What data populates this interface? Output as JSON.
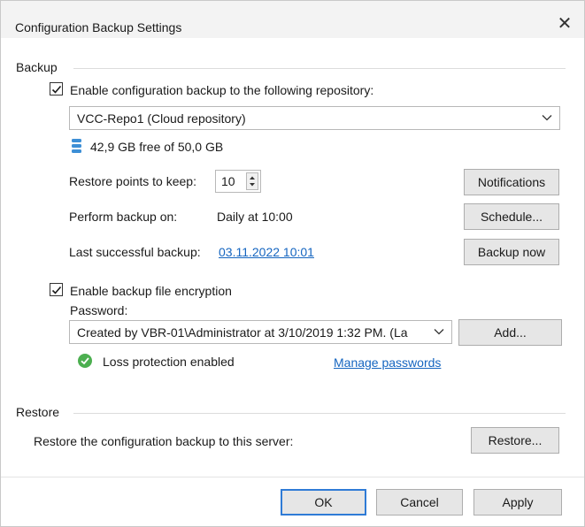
{
  "dialog": {
    "title": "Configuration Backup Settings"
  },
  "backup": {
    "group_label": "Backup",
    "enable_label": "Enable configuration backup to the following repository:",
    "enabled": true,
    "repository": "VCC-Repo1 (Cloud repository)",
    "storage_info": "42,9 GB free of 50,0 GB",
    "restore_points_label": "Restore points to keep:",
    "restore_points_value": "10",
    "notifications_label": "Notifications",
    "perform_label": "Perform backup on:",
    "perform_value": "Daily at 10:00",
    "schedule_label": "Schedule...",
    "last_label": "Last successful backup:",
    "last_value": "03.11.2022 10:01",
    "backup_now_label": "Backup now"
  },
  "encryption": {
    "enable_label": "Enable backup file encryption",
    "enabled": true,
    "password_label": "Password:",
    "password_value": "Created by VBR-01\\Administrator at 3/10/2019 1:32 PM. (La",
    "add_label": "Add...",
    "status": "Loss protection enabled",
    "manage_link": "Manage passwords"
  },
  "restore": {
    "group_label": "Restore",
    "description": "Restore the configuration backup to this server:",
    "button_label": "Restore..."
  },
  "footer": {
    "ok_label": "OK",
    "cancel_label": "Cancel",
    "apply_label": "Apply"
  },
  "colors": {
    "link": "#1565c0",
    "success": "#4caf50",
    "storage_icon": "#3d8fd6",
    "default_button_border": "#2f7bd6"
  },
  "icons": {
    "close": "close-icon",
    "checkbox_check": "checkmark-icon",
    "dropdown": "chevron-down-icon",
    "storage": "database-icon",
    "status": "check-circle-icon",
    "spinner_up": "arrow-up-icon",
    "spinner_down": "arrow-down-icon"
  }
}
